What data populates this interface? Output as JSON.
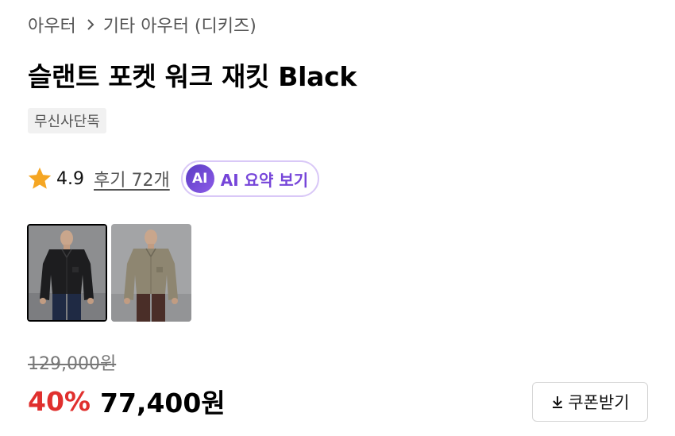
{
  "breadcrumb": {
    "category": "아우터",
    "subcategory": "기타 아우터 (디키즈)"
  },
  "product": {
    "title": "슬랜트 포켓 워크 재킷 Black",
    "badge": "무신사단독",
    "rating": "4.9",
    "review_link": "후기 72개",
    "ai_badge": "AI",
    "ai_summary_label": "AI 요약 보기"
  },
  "thumbnails": [
    {
      "name": "black jacket",
      "selected": true
    },
    {
      "name": "khaki jacket",
      "selected": false
    }
  ],
  "pricing": {
    "original_price": "129,000원",
    "discount": "40%",
    "sale_price": "77,400원",
    "coupon_label": "쿠폰받기"
  },
  "icons": {
    "breadcrumb_separator": "chevron-right-icon",
    "rating": "star-icon",
    "coupon": "download-icon"
  },
  "colors": {
    "star": "#f5a623",
    "discount": "#e0302e",
    "ai_accent": "#7645d9",
    "badge_bg": "#f1f1f1"
  }
}
